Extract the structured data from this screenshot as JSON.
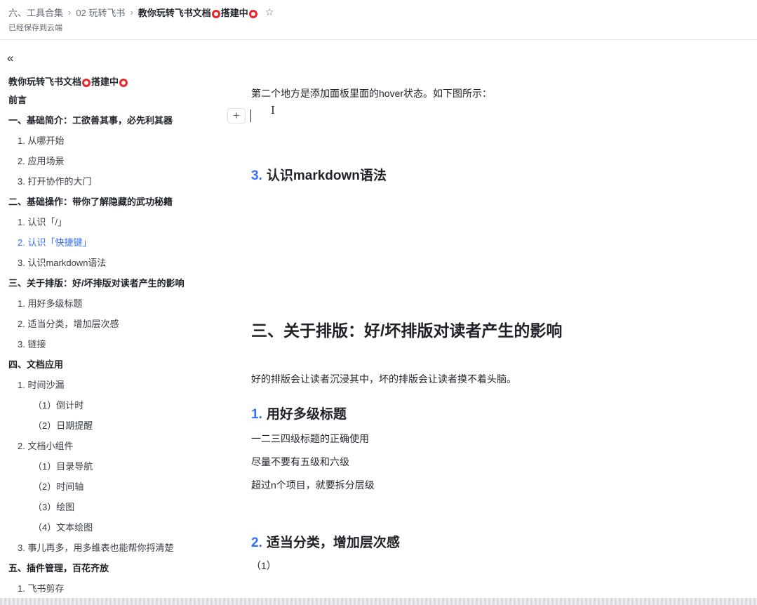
{
  "breadcrumb": {
    "items": [
      "六、工具合集",
      "02 玩转飞书"
    ],
    "current_prefix": "教你玩转飞书文档",
    "current_mid": "搭建中",
    "saved_status": "已经保存到云端"
  },
  "sidebar": {
    "collapse_icon": "«",
    "title_prefix": "教你玩转飞书文档",
    "title_mid": "搭建中",
    "items": [
      {
        "label": "前言"
      },
      {
        "label": "一、基础简介：工欲善其事，必先利其器"
      },
      {
        "label": "1. 从哪开始"
      },
      {
        "label": "2. 应用场景"
      },
      {
        "label": "3. 打开协作的大门"
      },
      {
        "label": "二、基础操作：带你了解隐藏的武功秘籍"
      },
      {
        "label": "1. 认识「/」"
      },
      {
        "label": "2. 认识「快捷键」"
      },
      {
        "label": "3. 认识markdown语法"
      },
      {
        "label": "三、关于排版：好/坏排版对读者产生的影响"
      },
      {
        "label": "1. 用好多级标题"
      },
      {
        "label": "2. 适当分类，增加层次感"
      },
      {
        "label": "3. 链接"
      },
      {
        "label": "四、文档应用"
      },
      {
        "label": "1. 时间沙漏"
      },
      {
        "label": "（1）倒计时"
      },
      {
        "label": "（2）日期提醒"
      },
      {
        "label": "2. 文档小组件"
      },
      {
        "label": "（1）目录导航"
      },
      {
        "label": "（2）时间轴"
      },
      {
        "label": "（3）绘图"
      },
      {
        "label": "（4）文本绘图"
      },
      {
        "label": "3. 事儿再多，用多维表也能帮你捋清楚"
      },
      {
        "label": "五、插件管理，百花齐放"
      },
      {
        "label": "1. 飞书剪存"
      }
    ]
  },
  "content": {
    "para1": "第二个地方是添加面板里面的hover状态。如下图所示：",
    "plus_icon": "+",
    "h2_markdown_num": "3.",
    "h2_markdown_text": "认识markdown语法",
    "h1_layout": "三、关于排版：好/坏排版对读者产生的影响",
    "para2": "好的排版会让读者沉浸其中，坏的排版会让读者摸不着头脑。",
    "h2_headings_num": "1.",
    "h2_headings_text": "用好多级标题",
    "line1": "一二三四级标题的正确使用",
    "line2": "尽量不要有五级和六级",
    "line3": "超过n个项目，就要拆分层级",
    "h2_classify_num": "2.",
    "h2_classify_text": "适当分类，增加层次感",
    "line4": "（1）"
  }
}
